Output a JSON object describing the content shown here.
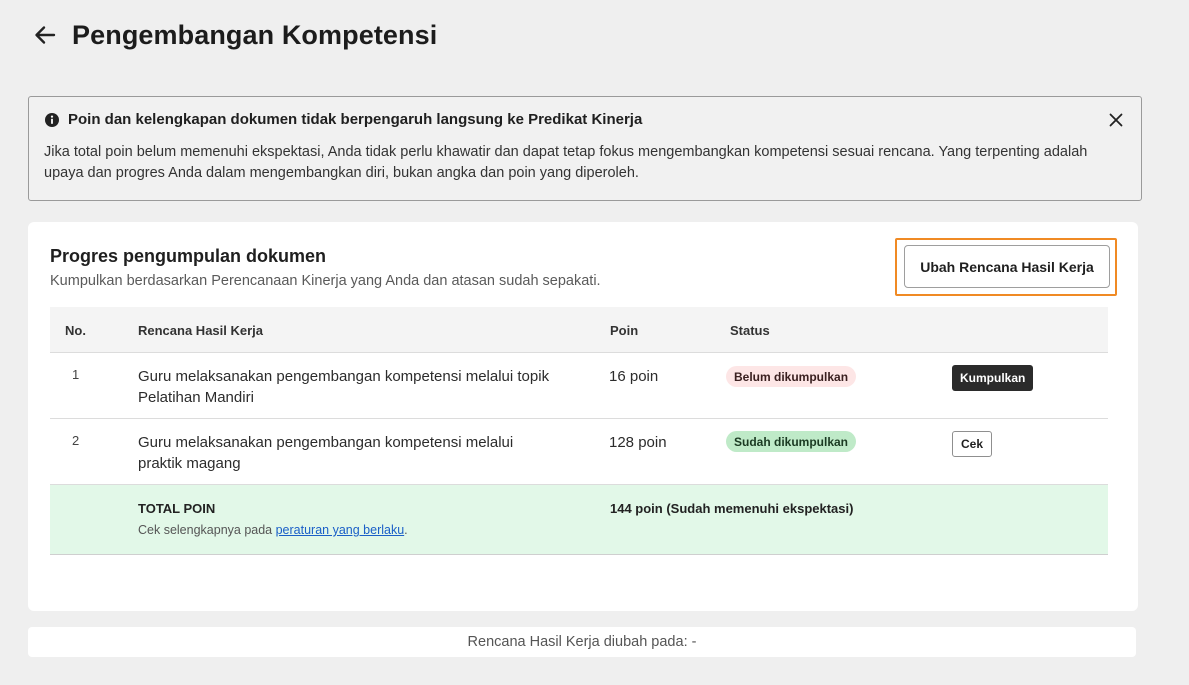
{
  "header": {
    "title": "Pengembangan Kompetensi",
    "back_icon": "arrow-left-icon"
  },
  "alert": {
    "title": "Poin dan kelengkapan dokumen tidak berpengaruh langsung ke Predikat Kinerja",
    "body": "Jika total poin belum memenuhi ekspektasi, Anda tidak perlu khawatir dan dapat tetap fokus mengembangkan kompetensi sesuai rencana. Yang terpenting adalah upaya dan progres Anda dalam mengembangkan diri, bukan angka dan poin yang diperoleh.",
    "icons": {
      "info": "info-icon",
      "close": "close-icon"
    }
  },
  "card": {
    "title": "Progres pengumpulan dokumen",
    "subtitle": "Kumpulkan berdasarkan Perencanaan Kinerja yang Anda dan atasan sudah sepakati.",
    "edit_button": "Ubah Rencana Hasil Kerja",
    "highlight_color": "#f08a24"
  },
  "table": {
    "headers": [
      "No.",
      "Rencana Hasil Kerja",
      "Poin",
      "Status"
    ],
    "rows": [
      {
        "no": "1",
        "task": "Guru melaksanakan pengembangan kompetensi melalui topik Pelatihan Mandiri",
        "points": "16 poin",
        "status": "Belum dikumpulkan",
        "action": "Kumpulkan"
      },
      {
        "no": "2",
        "task": "Guru melaksanakan pengembangan kompetensi melalui praktik magang",
        "points": "128 poin",
        "status": "Sudah dikumpulkan",
        "action": "Cek"
      }
    ],
    "total": {
      "label": "TOTAL POIN",
      "note_prefix": "Cek selengkapnya pada ",
      "note_link": "peraturan yang berlaku",
      "note_suffix": ".",
      "value": "144 poin (Sudah memenuhi ekspektasi)"
    }
  },
  "footer": {
    "text": "Rencana Hasil Kerja diubah pada: -"
  },
  "colors": {
    "status_pending_bg": "#fde6e6",
    "status_done_bg": "#bfeac8",
    "total_row_bg": "#e2f8e8",
    "link": "#1a5fc7"
  }
}
